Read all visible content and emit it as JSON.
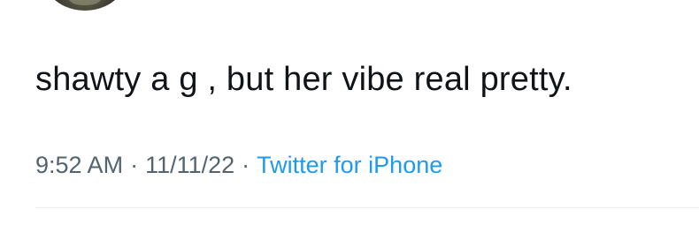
{
  "tweet": {
    "text": "shawty a g , but her vibe real pretty.",
    "time": "9:52 AM",
    "separator": "·",
    "date": "11/11/22",
    "source": "Twitter for iPhone"
  },
  "colors": {
    "text": "#0f1419",
    "meta": "#536471",
    "link": "#1d9bf0",
    "divider": "#e6ecf0"
  }
}
